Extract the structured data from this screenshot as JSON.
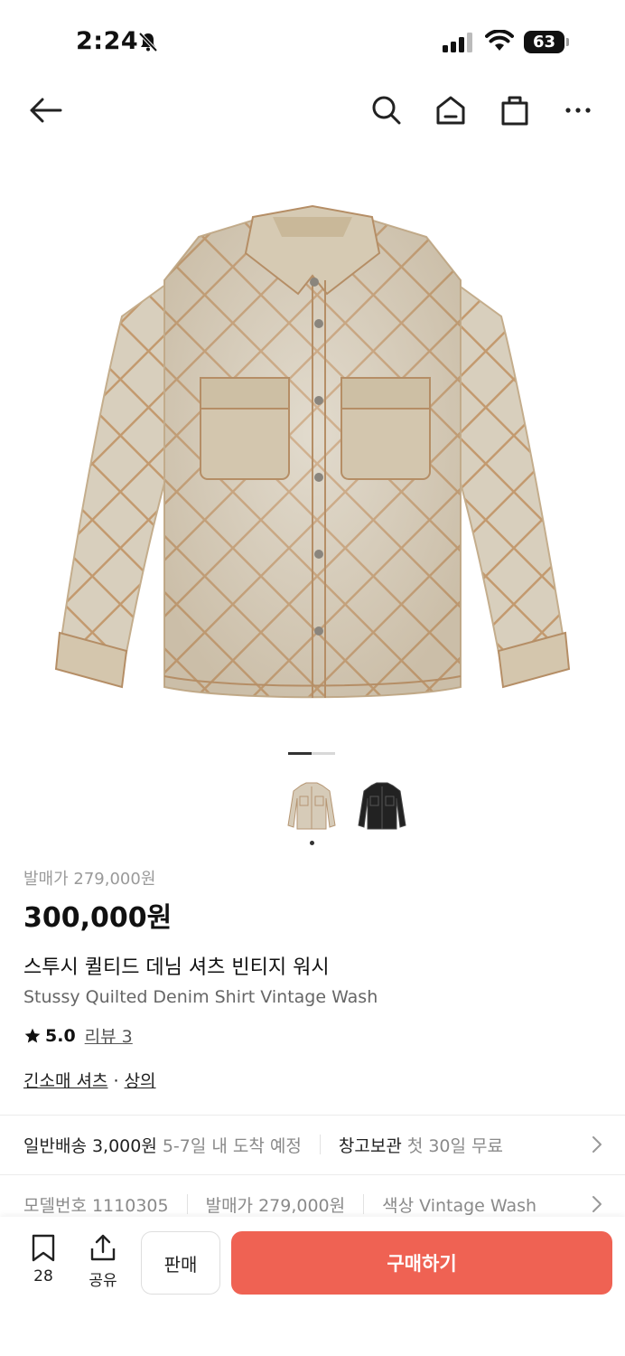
{
  "status": {
    "time": "2:24",
    "battery": "63"
  },
  "nav": {
    "back": "back-arrow",
    "search": "search-icon",
    "home": "home-icon",
    "bag": "shopping-bag-icon",
    "more": "more-icon"
  },
  "product": {
    "release_price": "발매가 279,000원",
    "price": "300,000원",
    "title_ko": "스투시 퀼티드 데님 셔츠 빈티지 워시",
    "title_en": "Stussy Quilted Denim Shirt Vintage Wash",
    "rating": "5.0",
    "review_link": "리뷰 3",
    "category_1": "긴소매 셔츠",
    "category_sep": " · ",
    "category_2": "상의"
  },
  "delivery": {
    "standard_label": "일반배송 3,000원",
    "standard_eta": "5-7일 내 도착 예정",
    "warehouse_label": "창고보관",
    "warehouse_note": "첫 30일 무료"
  },
  "specs": {
    "model": "모델번호 1110305",
    "release": "발매가 279,000원",
    "color": "색상 Vintage Wash"
  },
  "bottom": {
    "bookmark_count": "28",
    "share_label": "공유",
    "sell_label": "판매",
    "buy_label": "구매하기"
  },
  "colors": {
    "accent": "#ef6253",
    "jacket": "#d6cbb8",
    "jacket_stitch": "#c49a70",
    "thumb_black": "#222222"
  }
}
